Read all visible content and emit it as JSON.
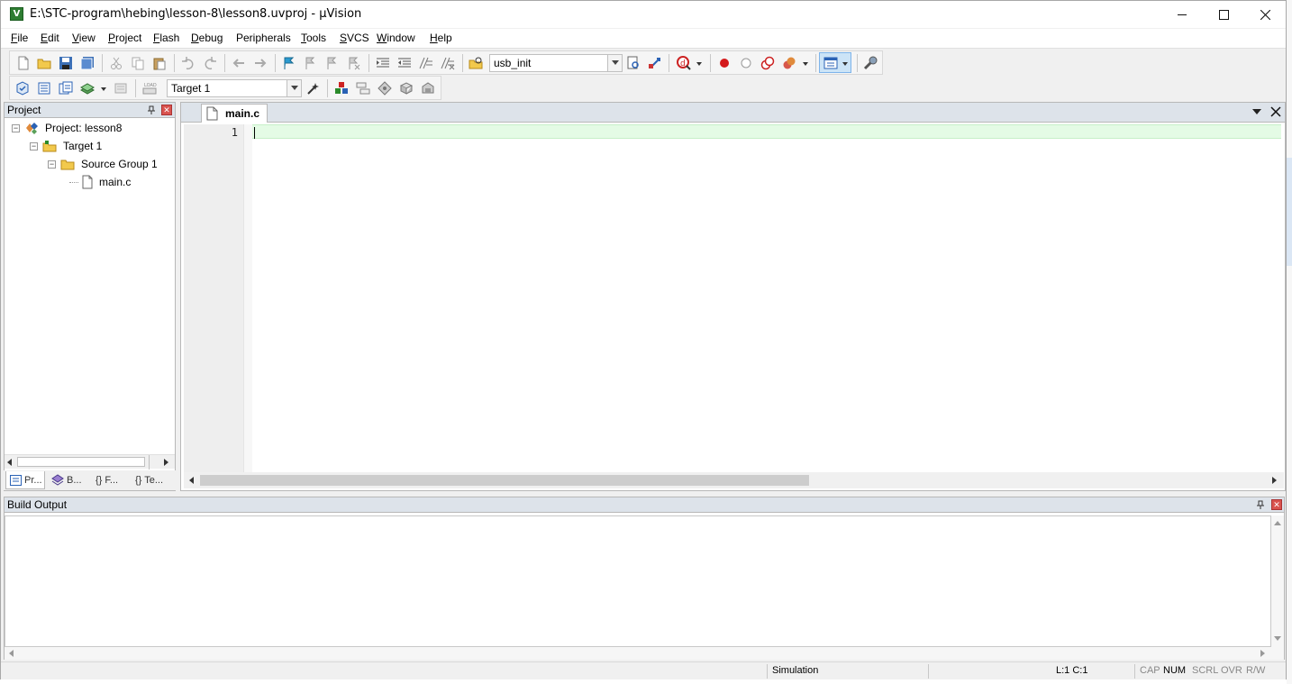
{
  "window": {
    "title": "E:\\STC-program\\hebing\\lesson-8\\lesson8.uvproj - µVision",
    "app_icon_letter": "V"
  },
  "menu": [
    {
      "label": "File",
      "key": "F",
      "rest": "ile"
    },
    {
      "label": "Edit",
      "key": "E",
      "rest": "dit"
    },
    {
      "label": "View",
      "key": "V",
      "rest": "iew"
    },
    {
      "label": "Project",
      "key": "P",
      "rest": "roject"
    },
    {
      "label": "Flash",
      "key": "F",
      "rest": "lash"
    },
    {
      "label": "Debug",
      "key": "D",
      "rest": "ebug"
    },
    {
      "label": "Peripherals",
      "key": "",
      "rest": "Peripherals"
    },
    {
      "label": "Tools",
      "key": "T",
      "rest": "ools"
    },
    {
      "label": "SVCS",
      "key": "S",
      "rest": "VCS"
    },
    {
      "label": "Window",
      "key": "W",
      "rest": "indow"
    },
    {
      "label": "Help",
      "key": "H",
      "rest": "elp"
    }
  ],
  "toolbar": {
    "find_combo_value": "usb_init",
    "target_combo_value": "Target 1"
  },
  "project_panel": {
    "title": "Project",
    "tree": {
      "project": "Project: lesson8",
      "target": "Target 1",
      "group": "Source Group 1",
      "file": "main.c"
    },
    "tabs": [
      "Pr...",
      "B...",
      "F...",
      "Te..."
    ],
    "tab_prefixes": [
      "",
      "",
      "{}",
      "{}"
    ]
  },
  "editor": {
    "tab_label": "main.c",
    "line_numbers": [
      "1"
    ]
  },
  "build_output": {
    "title": "Build Output"
  },
  "status": {
    "mode": "Simulation",
    "position": "L:1 C:1",
    "cap": "CAP",
    "num": "NUM",
    "scrl": "SCRL",
    "ovr": "OVR",
    "rw": "R/W"
  },
  "colors": {
    "current_line": "#e4fbe5",
    "panel_header": "#dde3ea",
    "close_red": "#d9534f"
  }
}
